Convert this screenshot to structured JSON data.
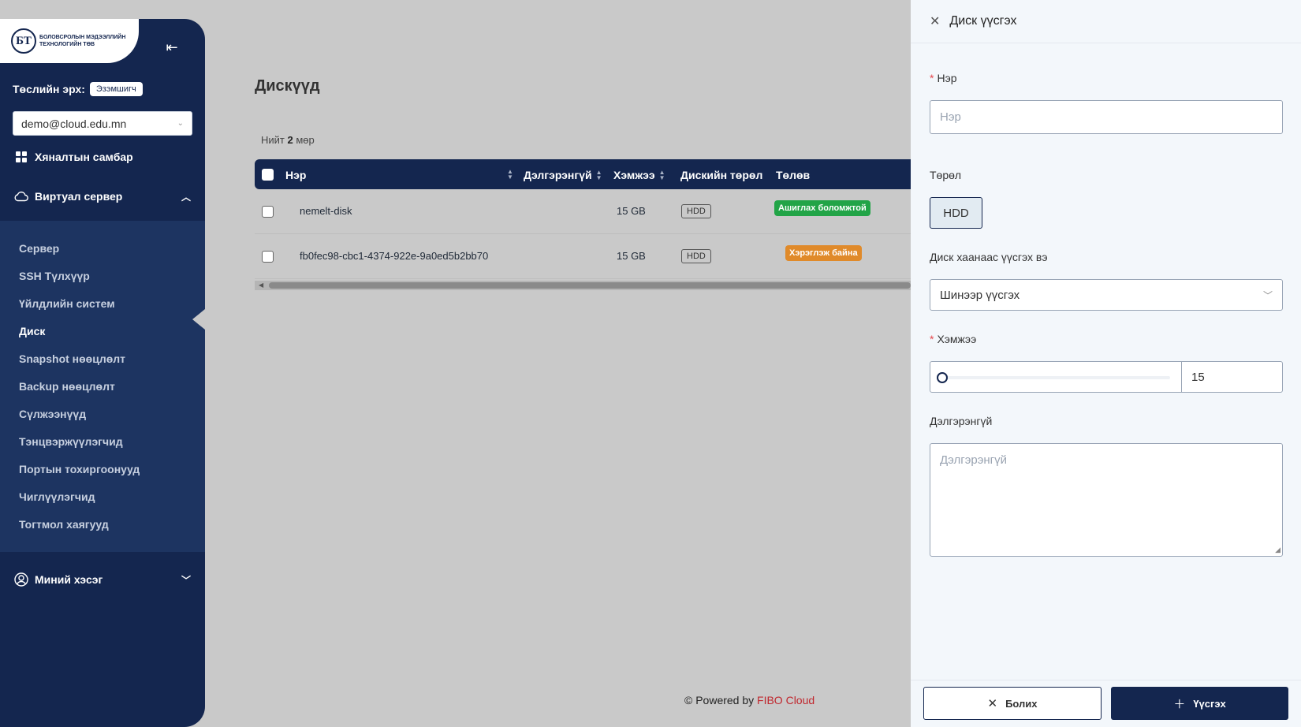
{
  "sidebar": {
    "logo_letters": "БТ",
    "logo_text": "БОЛОВСРОЛЫН МЭДЭЭЛЛИЙН ТЕХНОЛОГИЙН ТӨВ",
    "role_label": "Төслийн эрх:",
    "role_badge": "Эзэмшигч",
    "account": "demo@cloud.edu.mn",
    "dashboard": "Хяналтын самбар",
    "virtual_server": "Виртуал сервер",
    "sub_items": [
      {
        "label": "Сервер"
      },
      {
        "label": "SSH Түлхүүр"
      },
      {
        "label": "Үйлдлийн систем"
      },
      {
        "label": "Диск"
      },
      {
        "label": "Snapshot нөөцлөлт"
      },
      {
        "label": "Backup нөөцлөлт"
      },
      {
        "label": "Сүлжээнүүд"
      },
      {
        "label": "Тэнцвэржүүлэгчид"
      },
      {
        "label": "Портын тохиргоонууд"
      },
      {
        "label": "Чиглүүлэгчид"
      },
      {
        "label": "Тогтмол хаягууд"
      }
    ],
    "my_section": "Миний хэсэг"
  },
  "main": {
    "title": "Дискүүд",
    "total_prefix": "Нийт",
    "total_count": "2",
    "total_suffix": "мөр",
    "columns": {
      "name": "Нэр",
      "description": "Дэлгэрэнгүй",
      "size": "Хэмжээ",
      "disk_type": "Дискийн төрөл",
      "status": "Төлөв"
    },
    "rows": [
      {
        "name": "nemelt-disk",
        "size": "15 GB",
        "type": "HDD",
        "status": "Ашиглах боломжтой",
        "status_color": "#22a447"
      },
      {
        "name": "fb0fec98-cbc1-4374-922e-9a0ed5b2bb70",
        "size": "15 GB",
        "type": "HDD",
        "status": "Хэрэглэж байна",
        "status_color": "#e08a2a"
      }
    ],
    "footer_prefix": "© Powered by",
    "footer_brand": "FIBO Cloud"
  },
  "drawer": {
    "title": "Диск үүсгэх",
    "name_label": "Нэр",
    "name_placeholder": "Нэр",
    "type_label": "Төрөл",
    "type_value": "HDD",
    "source_label": "Диск хаанаас үүсгэх вэ",
    "source_value": "Шинээр үүсгэх",
    "size_label": "Хэмжээ",
    "size_value": "15",
    "size_slider_fraction": 0,
    "desc_label": "Дэлгэрэнгүй",
    "desc_placeholder": "Дэлгэрэнгүй",
    "cancel_label": "Болих",
    "create_label": "Үүсгэх"
  },
  "colors": {
    "primary": "#14264f",
    "available": "#22a447",
    "in_use": "#e08a2a",
    "brand_red": "#c0262d"
  }
}
